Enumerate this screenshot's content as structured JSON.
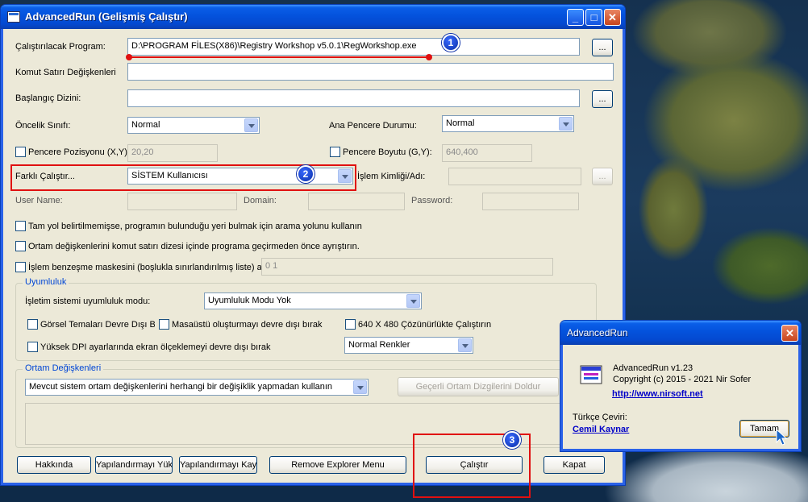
{
  "window": {
    "title": "AdvancedRun (Gelişmiş Çalıştır)",
    "controls": {
      "minimize": "_",
      "maximize": "□",
      "close": "✕"
    }
  },
  "form": {
    "program_label": "Çalıştırılacak Program:",
    "program_value": "D:\\PROGRAM FİLES(X86)\\Registry Workshop v5.0.1\\RegWorkshop.exe",
    "browse_label": "...",
    "cmdline_label": "Komut Satırı Değişkenleri",
    "cmdline_value": "",
    "startdir_label": "Başlangıç Dizini:",
    "startdir_value": "",
    "priority_label": "Öncelik Sınıfı:",
    "priority_value": "Normal",
    "mainwin_label": "Ana Pencere Durumu:",
    "mainwin_value": "Normal",
    "winpos_label": "Pencere Pozisyonu (X,Y):",
    "winpos_value": "20,20",
    "winsize_label": "Pencere Boyutu (G,Y):",
    "winsize_value": "640,400",
    "runas_label": "Farklı Çalıştır...",
    "runas_value": "SİSTEM Kullanıcısı",
    "process_label": "İşlem Kimliği/Adı:",
    "process_value": "",
    "username_label": "User Name:",
    "domain_label": "Domain:",
    "password_label": "Password:",
    "opt1_label": "Tam yol belirtilmemişse, programın bulunduğu yeri bulmak için arama yolunu kullanın",
    "opt2_label": "Ortam değişkenlerini komut satırı dizesi içinde programa geçirmeden önce ayrıştırın.",
    "opt3_label": "İşlem benzeşme maskesini (boşlukla sınırlandırılmış liste) aya",
    "affinity_value": "0 1"
  },
  "compat": {
    "group_title": "Uyumluluk",
    "os_label": "İşletim sistemi uyumluluk modu:",
    "os_value": "Uyumluluk Modu Yok",
    "themes_label": "Görsel Temaları Devre Dışı Bıra",
    "desktop_label": "Masaüstü oluşturmayı devre dışı bırak",
    "res_label": "640 X 480 Çözünürlükte Çalıştırın",
    "dpi_label": "Yüksek DPI ayarlarında ekran ölçeklemeyi devre dışı bırak",
    "colors_value": "Normal Renkler"
  },
  "env": {
    "group_title": "Ortam Değişkenleri",
    "mode_value": "Mevcut sistem ortam değişkenlerini herhangi bir değişiklik yapmadan kullanın",
    "fill_button": "Geçerli Ortam Dizgilerini Doldur"
  },
  "buttons": {
    "about": "Hakkında",
    "load": "Yapılandırmayı Yükle",
    "save": "Yapılandırmayı Kayde",
    "remove_menu": "Remove Explorer Menu",
    "run": "Çalıştır",
    "close": "Kapat"
  },
  "markers": {
    "m1": "1",
    "m2": "2",
    "m3": "3"
  },
  "about_dialog": {
    "title": "AdvancedRun",
    "close": "✕",
    "version": "AdvancedRun v1.23",
    "copyright": "Copyright (c) 2015 - 2021 Nir Sofer",
    "url": "http://www.nirsoft.net",
    "translation_label": "Türkçe Çeviri:",
    "translator": "Cemil Kaynar",
    "ok": "Tamam"
  },
  "colors": {
    "annotation_red": "#e01010",
    "xp_blue": "#0452dc",
    "face": "#ece9d8"
  }
}
